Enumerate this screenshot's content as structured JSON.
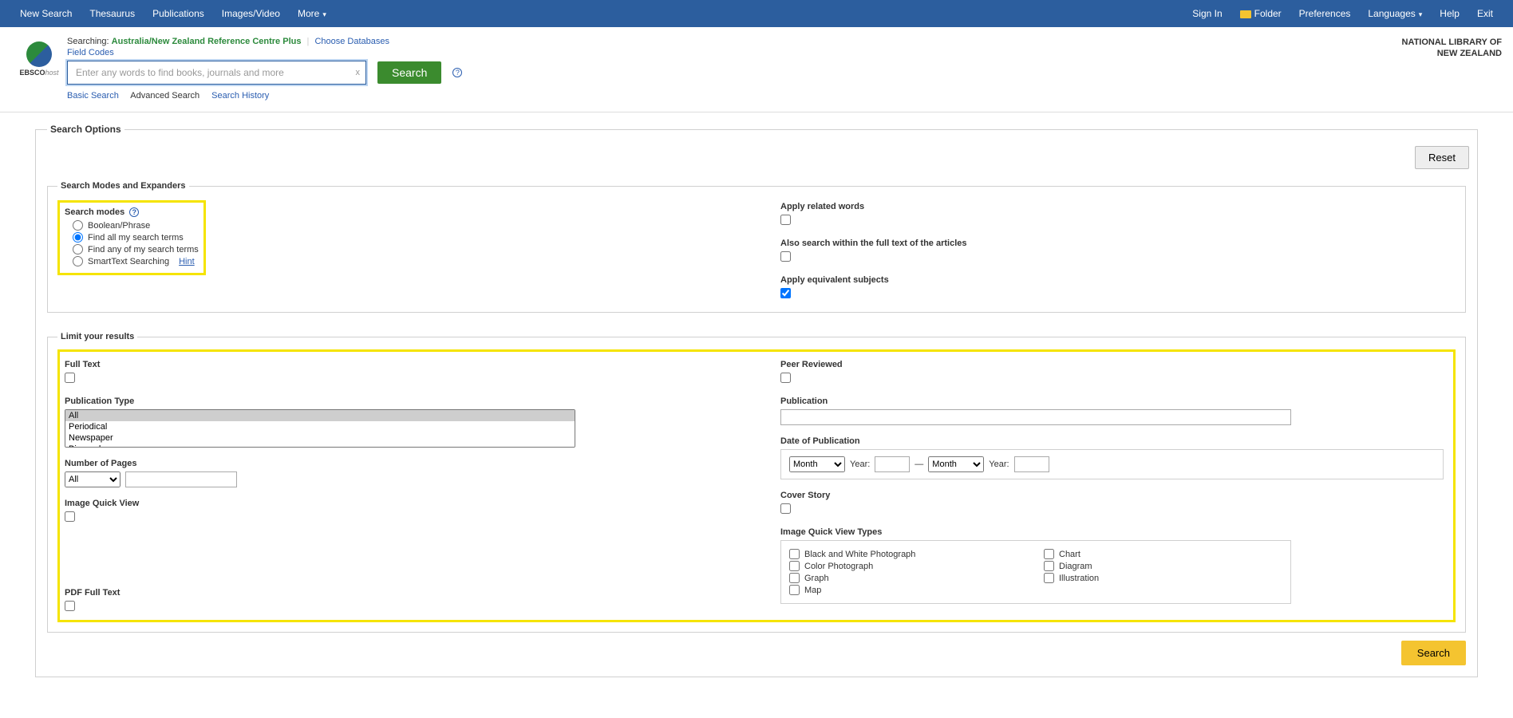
{
  "topbar": {
    "left": [
      "New Search",
      "Thesaurus",
      "Publications",
      "Images/Video",
      "More"
    ],
    "right": [
      "Sign In",
      "Folder",
      "Preferences",
      "Languages",
      "Help",
      "Exit"
    ]
  },
  "logo": {
    "brand": "EBSCO",
    "suffix": "host"
  },
  "searching": {
    "prefix": "Searching:",
    "dbname": "Australia/New Zealand Reference Centre Plus",
    "choose": "Choose Databases",
    "fieldcodes": "Field Codes"
  },
  "search": {
    "placeholder": "Enter any words to find books, journals and more",
    "button": "Search",
    "clear": "x"
  },
  "modes": {
    "basic": "Basic Search",
    "advanced": "Advanced Search",
    "history": "Search History"
  },
  "org": {
    "line1": "NATIONAL LIBRARY OF",
    "line2": "NEW ZEALAND"
  },
  "options": {
    "legend": "Search Options",
    "reset": "Reset",
    "modes_expanders": {
      "legend": "Search Modes and Expanders",
      "search_modes_label": "Search modes",
      "radios": [
        "Boolean/Phrase",
        "Find all my search terms",
        "Find any of my search terms",
        "SmartText Searching"
      ],
      "hint": "Hint",
      "apply_related": "Apply related words",
      "also_fulltext": "Also search within the full text of the articles",
      "apply_equiv": "Apply equivalent subjects"
    },
    "limit": {
      "legend": "Limit your results",
      "fulltext": "Full Text",
      "pubtype_label": "Publication Type",
      "pubtype_options": [
        "All",
        "Periodical",
        "Newspaper",
        "Biography"
      ],
      "num_pages": "Number of Pages",
      "num_pages_opt": "All",
      "iqv": "Image Quick View",
      "pdf": "PDF Full Text",
      "peer": "Peer Reviewed",
      "publication": "Publication",
      "date_label": "Date of Publication",
      "month": "Month",
      "year": "Year:",
      "dash": "—",
      "cover": "Cover Story",
      "iqv_types_label": "Image Quick View Types",
      "iqv_types_left": [
        "Black and White Photograph",
        "Color Photograph",
        "Graph",
        "Map"
      ],
      "iqv_types_right": [
        "Chart",
        "Diagram",
        "Illustration"
      ]
    },
    "bottom_search": "Search"
  }
}
